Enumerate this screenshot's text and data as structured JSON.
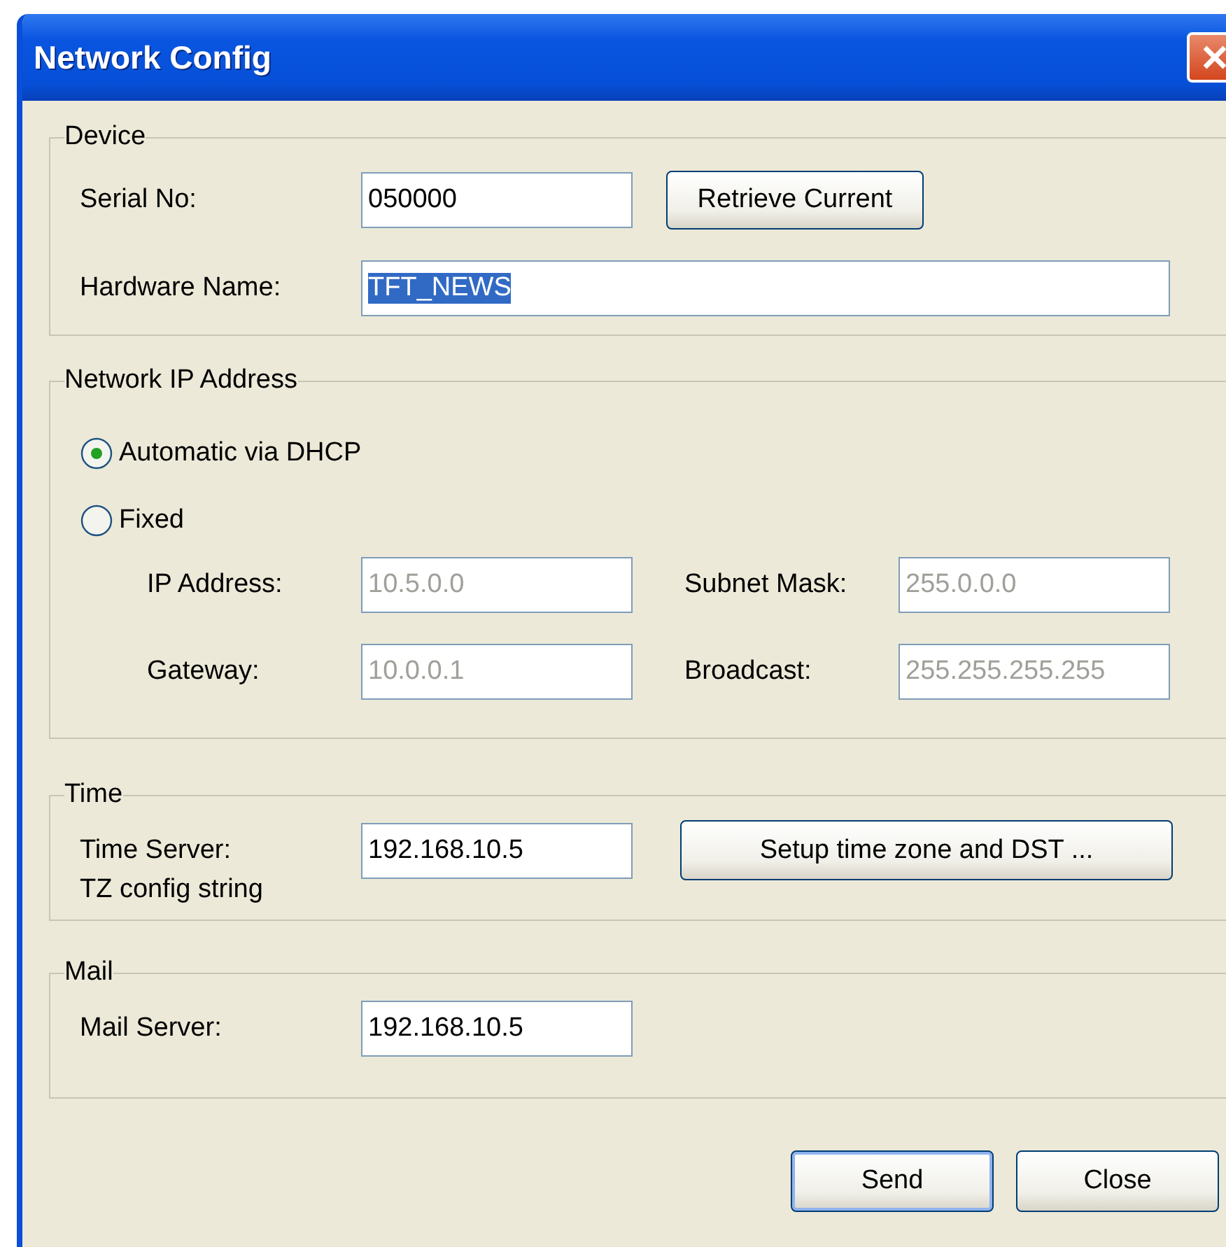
{
  "window": {
    "title": "Network Config"
  },
  "device": {
    "legend": "Device",
    "serial": {
      "label": "Serial No:",
      "value": "050000"
    },
    "retrieve_button": "Retrieve Current",
    "hardware": {
      "label": "Hardware Name:",
      "value": "TFT_NEWS",
      "text_selected": true
    }
  },
  "network": {
    "legend": "Network IP Address",
    "modes": [
      {
        "label": "Automatic via DHCP",
        "selected": true
      },
      {
        "label": "Fixed",
        "selected": false
      }
    ],
    "fields": [
      {
        "label": "IP Address:",
        "value": "10.5.0.0",
        "disabled": true
      },
      {
        "label": "Subnet Mask:",
        "value": "255.0.0.0",
        "disabled": true
      },
      {
        "label": "Gateway:",
        "value": "10.0.0.1",
        "disabled": true
      },
      {
        "label": "Broadcast:",
        "value": "255.255.255.255",
        "disabled": true
      }
    ]
  },
  "time": {
    "legend": "Time",
    "server": {
      "label": "Time Server:",
      "value": "192.168.10.5"
    },
    "note": "TZ config string",
    "setup_button": "Setup time zone and DST ..."
  },
  "mail": {
    "legend": "Mail",
    "server": {
      "label": "Mail Server:",
      "value": "192.168.10.5"
    }
  },
  "buttons": [
    {
      "label": "Send",
      "default": true
    },
    {
      "label": "Close",
      "default": false
    }
  ]
}
